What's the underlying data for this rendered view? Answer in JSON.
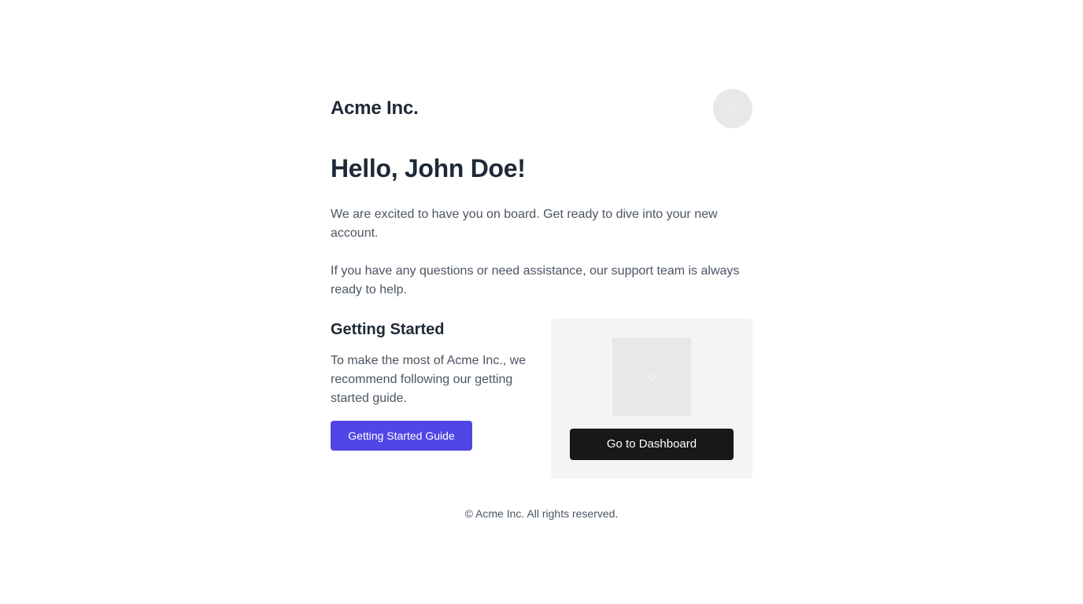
{
  "brand": {
    "name": "Acme Inc.",
    "avatar_icon": "image-placeholder-icon"
  },
  "greeting": "Hello, John Doe!",
  "paragraphs": [
    "We are excited to have you on board. Get ready to dive into your new account.",
    "If you have any questions or need assistance, our support team is always ready to help."
  ],
  "getting_started": {
    "title": "Getting Started",
    "text": "To make the most of Acme Inc., we recommend following our getting started guide.",
    "button_label": "Getting Started Guide"
  },
  "card": {
    "image_icon": "image-placeholder-icon",
    "button_label": "Go to Dashboard"
  },
  "footer": {
    "text": "© Acme Inc. All rights reserved."
  },
  "colors": {
    "primary_button": "#4f46e5",
    "dark_button": "#18181b",
    "card_background": "#f3f4f6",
    "heading_text": "#1f2937",
    "body_text": "#4b5563"
  }
}
